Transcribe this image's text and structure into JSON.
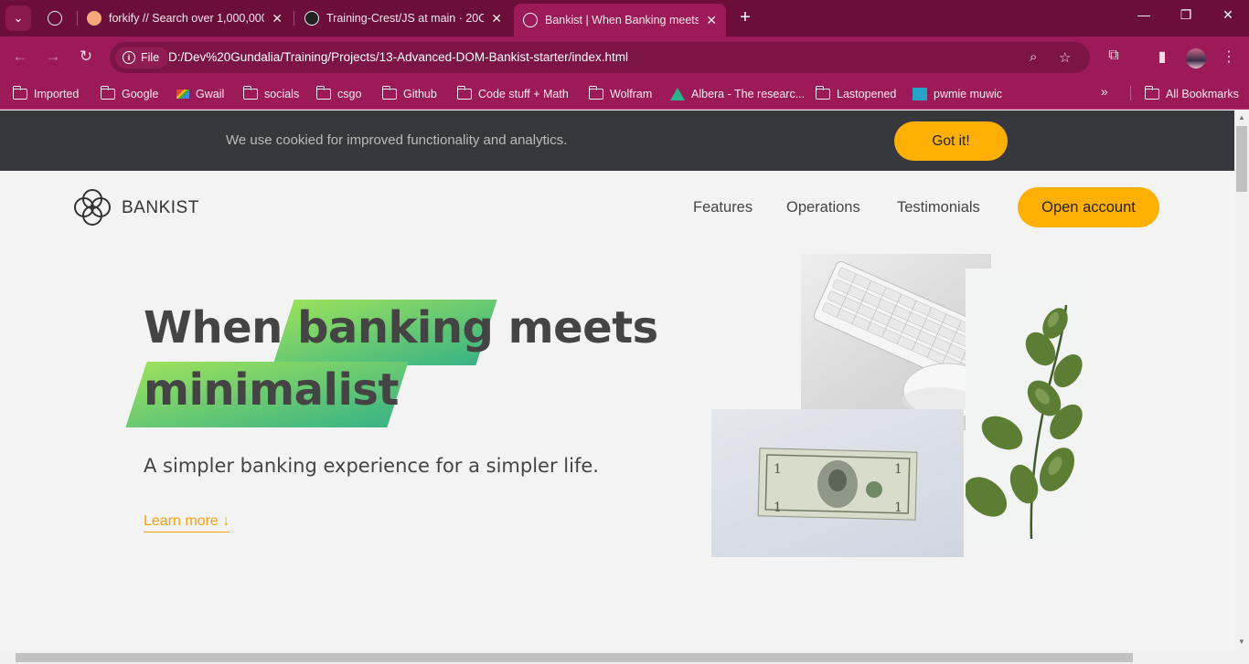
{
  "browser": {
    "tabs": [
      {
        "title": ""
      },
      {
        "title": "forkify // Search over 1,000,000"
      },
      {
        "title": "Training-Crest/JS at main · 20CE"
      },
      {
        "title": "Bankist | When Banking meets M"
      }
    ],
    "new_tab": "+",
    "address": {
      "chip_label": "File",
      "url": "D:/Dev%20Gundalia/Training/Projects/13-Advanced-DOM-Bankist-starter/index.html"
    },
    "bookmarks": [
      {
        "label": "Imported"
      },
      {
        "label": "Google"
      },
      {
        "label": "Gwail"
      },
      {
        "label": "socials"
      },
      {
        "label": "csgo"
      },
      {
        "label": "Github"
      },
      {
        "label": "Code stuff + Math"
      },
      {
        "label": "Wolfram"
      },
      {
        "label": "Albera - The researc..."
      },
      {
        "label": "Lastopened"
      },
      {
        "label": "pwmie muwic"
      }
    ],
    "bookmarks_more": "»",
    "all_bookmarks": "All Bookmarks",
    "theme_color": "#9c1a57"
  },
  "page": {
    "cookie": {
      "message": "We use cookied for improved functionality and analytics.",
      "button": "Got it!"
    },
    "nav": {
      "logo_text": "BANKIST",
      "links": [
        "Features",
        "Operations",
        "Testimonials"
      ],
      "cta": "Open account"
    },
    "hero": {
      "title_part1": "When",
      "title_highlight1": "banking",
      "title_part2": "meets",
      "title_highlight2": "minimalist",
      "subtitle": "A simpler banking experience for a simpler life.",
      "learn_more": "Learn more ↓"
    },
    "accent_color": "#ffb003"
  }
}
